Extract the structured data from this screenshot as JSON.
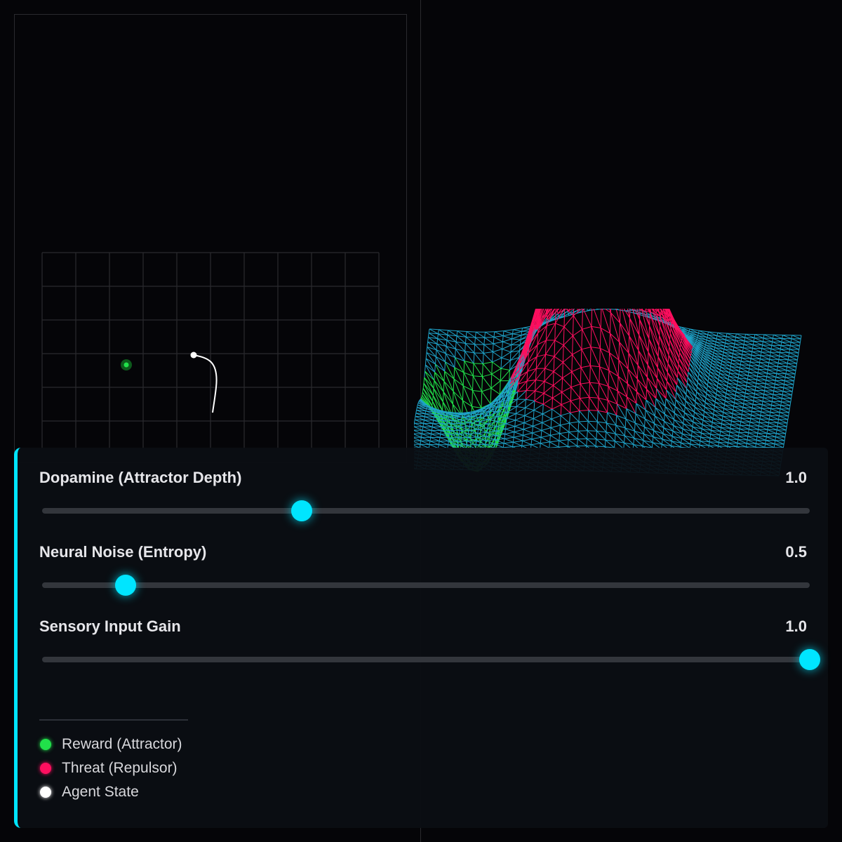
{
  "controls": [
    {
      "label": "Dopamine (Attractor Depth)",
      "value": "1.0",
      "fraction": 0.338
    },
    {
      "label": "Neural Noise (Entropy)",
      "value": "0.5",
      "fraction": 0.109
    },
    {
      "label": "Sensory Input Gain",
      "value": "1.0",
      "fraction": 1.0
    }
  ],
  "legend": [
    {
      "label": "Reward (Attractor)",
      "color": "#21e04a"
    },
    {
      "label": "Threat (Repulsor)",
      "color": "#ff0f5f"
    },
    {
      "label": "Agent State",
      "color": "#ffffff"
    }
  ],
  "colors": {
    "accent": "#00e5ff",
    "surface_mesh": "#1fa3c9",
    "reward": "#21e04a",
    "threat": "#ff0f5f",
    "agent": "#ffffff"
  }
}
